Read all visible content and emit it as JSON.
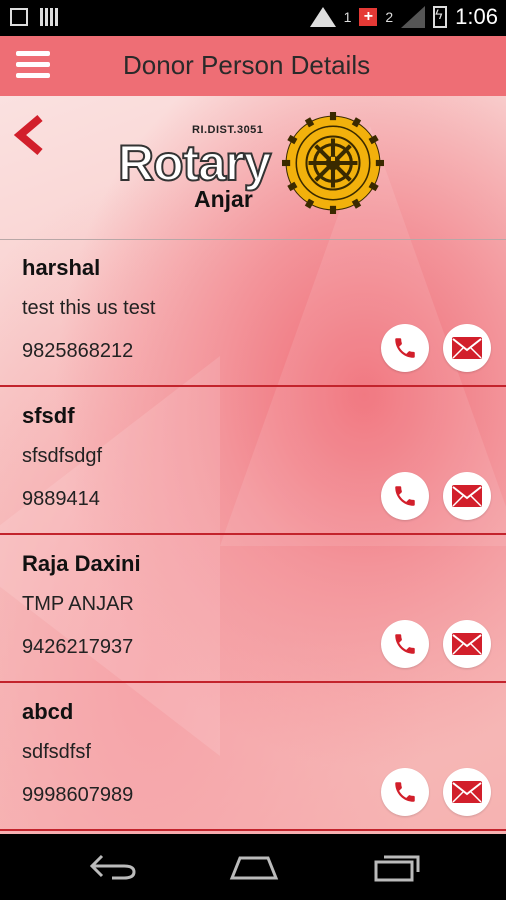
{
  "status_bar": {
    "time": "1:06",
    "sim1": "1",
    "sim2": "2"
  },
  "app_bar": {
    "title": "Donor Person Details",
    "menu_icon": "hamburger-menu-icon"
  },
  "header": {
    "back_icon": "chevron-left-icon",
    "logo": {
      "district": "RI.DIST.3051",
      "name": "Rotary",
      "club": "Anjar",
      "emblem": "rotary-wheel-icon"
    }
  },
  "donors": [
    {
      "name": "harshal",
      "note": "test this us test",
      "phone": "9825868212"
    },
    {
      "name": "sfsdf",
      "note": "sfsdfsdgf",
      "phone": "9889414"
    },
    {
      "name": "Raja Daxini",
      "note": "TMP ANJAR",
      "phone": "9426217937"
    },
    {
      "name": "abcd",
      "note": "sdfsdfsf",
      "phone": "9998607989"
    }
  ],
  "colors": {
    "app_bar": "#ee6e75",
    "accent_red": "#c3232c",
    "logo_gold": "#f2b10c"
  },
  "nav_bar": [
    "back-nav-icon",
    "home-nav-icon",
    "recent-apps-icon"
  ]
}
